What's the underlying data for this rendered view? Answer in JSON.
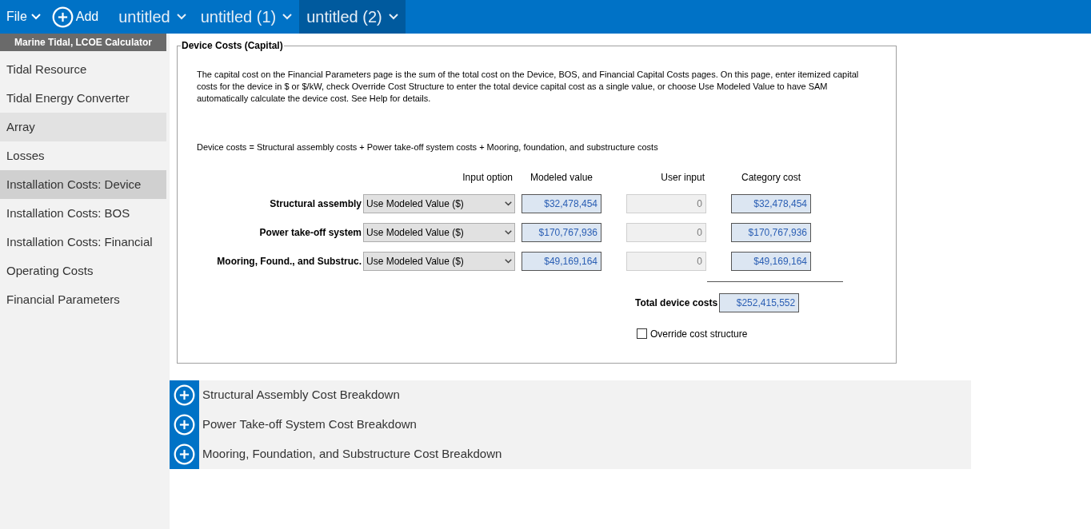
{
  "toolbar": {
    "file_menu": "File",
    "add_button": "Add"
  },
  "tabs": [
    {
      "label": "untitled",
      "selected": false
    },
    {
      "label": "untitled (1)",
      "selected": false
    },
    {
      "label": "untitled (2)",
      "selected": true
    }
  ],
  "sidebar": {
    "title": "Marine Tidal, LCOE Calculator",
    "items": [
      {
        "label": "Tidal Resource",
        "selected": false,
        "hovered": false
      },
      {
        "label": "Tidal Energy Converter",
        "selected": false,
        "hovered": false
      },
      {
        "label": "Array",
        "selected": false,
        "hovered": true
      },
      {
        "label": "Losses",
        "selected": false,
        "hovered": false
      },
      {
        "label": "Installation Costs: Device",
        "selected": true,
        "hovered": false
      },
      {
        "label": "Installation Costs: BOS",
        "selected": false,
        "hovered": false
      },
      {
        "label": "Installation Costs: Financial",
        "selected": false,
        "hovered": false
      },
      {
        "label": "Operating Costs",
        "selected": false,
        "hovered": false
      },
      {
        "label": "Financial Parameters",
        "selected": false,
        "hovered": false
      }
    ]
  },
  "group": {
    "title": "Device Costs (Capital)",
    "description": "The capital cost on the Financial Parameters page is the sum of the total cost on the Device, BOS, and Financial Capital Costs pages. On this page, enter itemized capital costs for the device in $ or $/kW, check Override Cost Structure to enter the total device capital cost as a single value, or choose Use Modeled Value to have SAM automatically calculate the device cost. See Help for details.",
    "formula": "Device costs = Structural assembly costs + Power take-off system costs + Mooring, foundation, and substructure costs",
    "columns": [
      "Input option",
      "Modeled value",
      "User input",
      "Category cost"
    ],
    "rows": [
      {
        "label": "Structural assembly",
        "input_option": "Use Modeled Value ($)",
        "modeled_value": "$32,478,454",
        "user_input": "0",
        "user_input_disabled": true,
        "category_cost": "$32,478,454"
      },
      {
        "label": "Power take-off system",
        "input_option": "Use Modeled Value ($)",
        "modeled_value": "$170,767,936",
        "user_input": "0",
        "user_input_disabled": true,
        "category_cost": "$170,767,936"
      },
      {
        "label": "Mooring, Found., and Substruc.",
        "input_option": "Use Modeled Value ($)",
        "modeled_value": "$49,169,164",
        "user_input": "0",
        "user_input_disabled": true,
        "category_cost": "$49,169,164"
      }
    ],
    "total": {
      "label": "Total device costs",
      "value": "$252,415,552"
    },
    "override": {
      "label": "Override cost structure",
      "checked": false
    }
  },
  "sections": [
    {
      "title": "Structural Assembly Cost Breakdown",
      "expanded": false
    },
    {
      "title": "Power Take-off System Cost Breakdown",
      "expanded": false
    },
    {
      "title": "Mooring, Foundation, and Substructure Cost Breakdown",
      "expanded": false
    }
  ]
}
